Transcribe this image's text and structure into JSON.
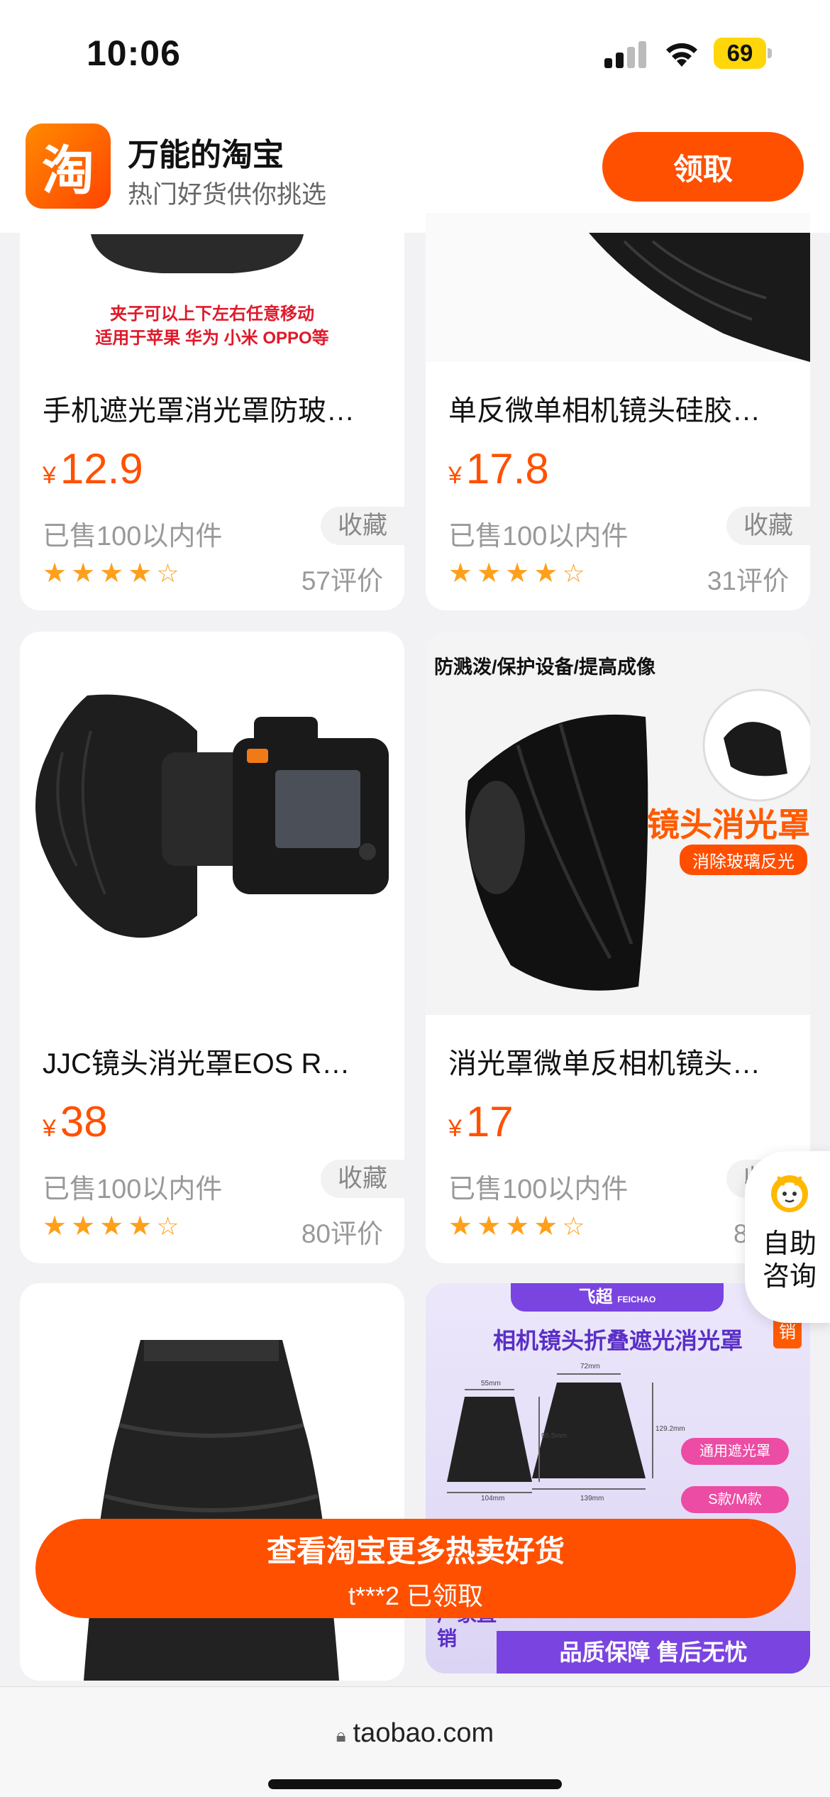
{
  "status_bar": {
    "time": "10:06",
    "battery": "69"
  },
  "app_banner": {
    "logo_char": "淘",
    "name": "万能的淘宝",
    "subtitle": "热门好货供你挑选",
    "claim_label": "领取"
  },
  "products": [
    {
      "image_caption_1": "夹子可以上下左右任意移动",
      "image_caption_2": "适用于苹果 华为 小米 OPPO等",
      "title": "手机遮光罩消光罩防玻…",
      "price_symbol": "¥",
      "price": "12.9",
      "sold": "已售100以内件",
      "fav_label": "收藏",
      "rating": 4,
      "reviews": "57评价"
    },
    {
      "title": "单反微单相机镜头硅胶…",
      "price_symbol": "¥",
      "price": "17.8",
      "sold": "已售100以内件",
      "fav_label": "收藏",
      "rating": 4,
      "reviews": "31评价"
    },
    {
      "title": "JJC镜头消光罩EOS R…",
      "price_symbol": "¥",
      "price": "38",
      "sold": "已售100以内件",
      "fav_label": "收藏",
      "rating": 4,
      "reviews": "80评价"
    },
    {
      "image_caption_1": "防溅泼/保护设备/提高成像",
      "image_caption_2": "镜头消光罩",
      "image_caption_3": "消除玻璃反光",
      "title": "消光罩微单反相机镜头…",
      "price_symbol": "¥",
      "price": "17",
      "sold": "已售100以内件",
      "fav_label": "收藏",
      "rating": 4,
      "reviews": "83评"
    },
    {
      "title": ""
    },
    {
      "image_brand": "飞超",
      "image_brand_en": "FEICHAO",
      "image_title": "相机镜头折叠遮光消光罩",
      "image_tag": "销",
      "image_dims": [
        "55mm",
        "95.5mm",
        "104mm",
        "72mm",
        "129.2mm",
        "139mm"
      ],
      "image_badge_1": "通用遮光罩",
      "image_badge_2": "S款/M款",
      "image_footer_left": "厂家直销",
      "image_footer": "品质保障  售后无忧"
    }
  ],
  "service": {
    "label": "自助咨询"
  },
  "cta": {
    "main": "查看淘宝更多热卖好货",
    "sub": "t***2 已领取"
  },
  "browser": {
    "url": "taobao.com"
  }
}
